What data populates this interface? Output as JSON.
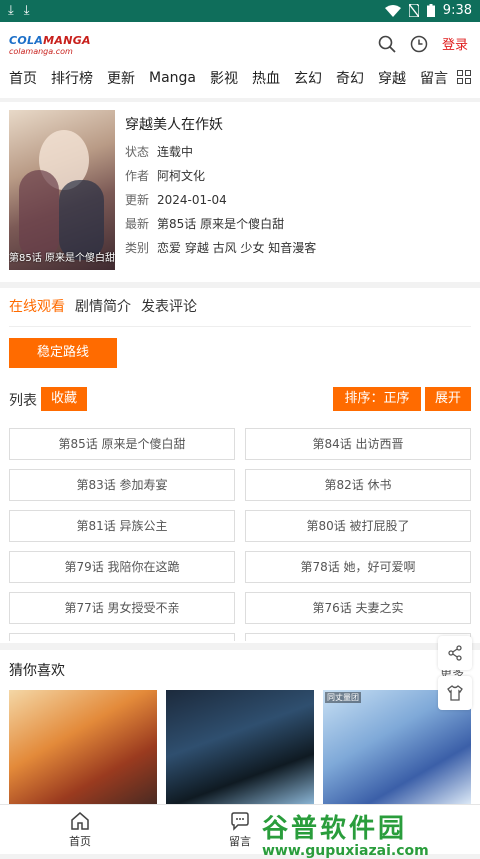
{
  "status_bar": {
    "time": "9:38"
  },
  "header": {
    "logo_line1_a": "COLA",
    "logo_line1_b": "MANGA",
    "logo_line2": "colamanga.com",
    "login": "登录"
  },
  "nav": {
    "items": [
      "首页",
      "排行榜",
      "更新",
      "Manga",
      "影视",
      "热血",
      "玄幻",
      "奇幻",
      "穿越",
      "留言"
    ]
  },
  "book": {
    "title": "穿越美人在作妖",
    "cover_caption": "第85话 原来是个傻白甜",
    "status_label": "状态",
    "status_value": "连载中",
    "author_label": "作者",
    "author_value": "阿柯文化",
    "update_label": "更新",
    "update_value": "2024-01-04",
    "latest_label": "最新",
    "latest_value": "第85话 原来是个傻白甜",
    "category_label": "类别",
    "category_value": "恋爱 穿越 古风 少女 知音漫客"
  },
  "tabs": [
    "在线观看",
    "剧情简介",
    "发表评论"
  ],
  "route_button": "稳定路线",
  "list": {
    "label": "列表",
    "favorite": "收藏",
    "sort": "排序：正序",
    "expand": "展开",
    "chapters": [
      "第85话 原来是个傻白甜",
      "第84话 出访西晋",
      "第83话 参加寿宴",
      "第82话 休书",
      "第81话 异族公主",
      "第80话 被打屁股了",
      "第79话 我陪你在这跪",
      "第78话 她，好可爱啊",
      "第77话 男女授受不亲",
      "第76话 夫妻之实"
    ]
  },
  "recommend": {
    "title": "猜你喜欢",
    "more": "更多",
    "thumb3_tag": "同丈量团"
  },
  "bottom_bar": {
    "home": "首页",
    "message": "留言"
  },
  "watermark": {
    "line1": "谷普软件园",
    "line2": "www.gupuxiazai.com"
  },
  "colors": {
    "accent": "#ff6b00",
    "status_bar": "#0f6e5b",
    "login": "#e02020"
  }
}
